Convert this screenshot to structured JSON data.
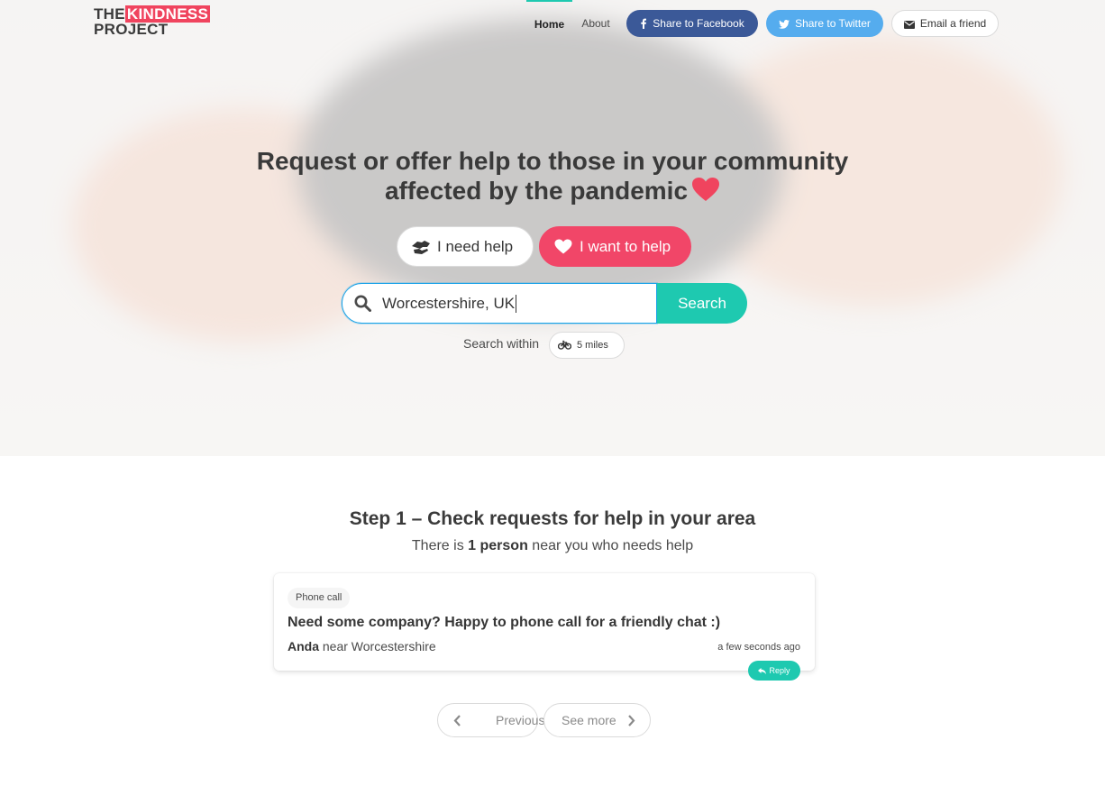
{
  "logo": {
    "line1_a": "THE",
    "line1_b": "KINDNESS",
    "line2": "PROJECT"
  },
  "nav": {
    "home": "Home",
    "about": "About"
  },
  "share": {
    "facebook": "Share to Facebook",
    "twitter": "Share to Twitter",
    "email": "Email a friend"
  },
  "hero": {
    "headline_line1": "Request or offer help to those in your community",
    "headline_line2": "affected by the pandemic",
    "toggle_need": "I need help",
    "toggle_want": "I want to help",
    "search_value": "Worcestershire, UK",
    "search_button": "Search",
    "within_label": "Search within",
    "within_value": "5 miles"
  },
  "step": {
    "title": "Step 1 – Check requests for help in your area",
    "sub_before": "There is ",
    "sub_count": "1 person",
    "sub_after": " near you who needs help"
  },
  "requests": [
    {
      "tag": "Phone call",
      "title": "Need some company? Happy to phone call for a friendly chat :)",
      "name": "Anda",
      "near": " near Worcestershire",
      "time": "a few seconds ago",
      "reply": "Reply"
    }
  ],
  "pagination": {
    "previous": "Previous",
    "next": "See more"
  },
  "colors": {
    "accent": "#1ec9b0",
    "pink": "#f14668",
    "facebook": "#3b5998",
    "twitter": "#55acee"
  }
}
